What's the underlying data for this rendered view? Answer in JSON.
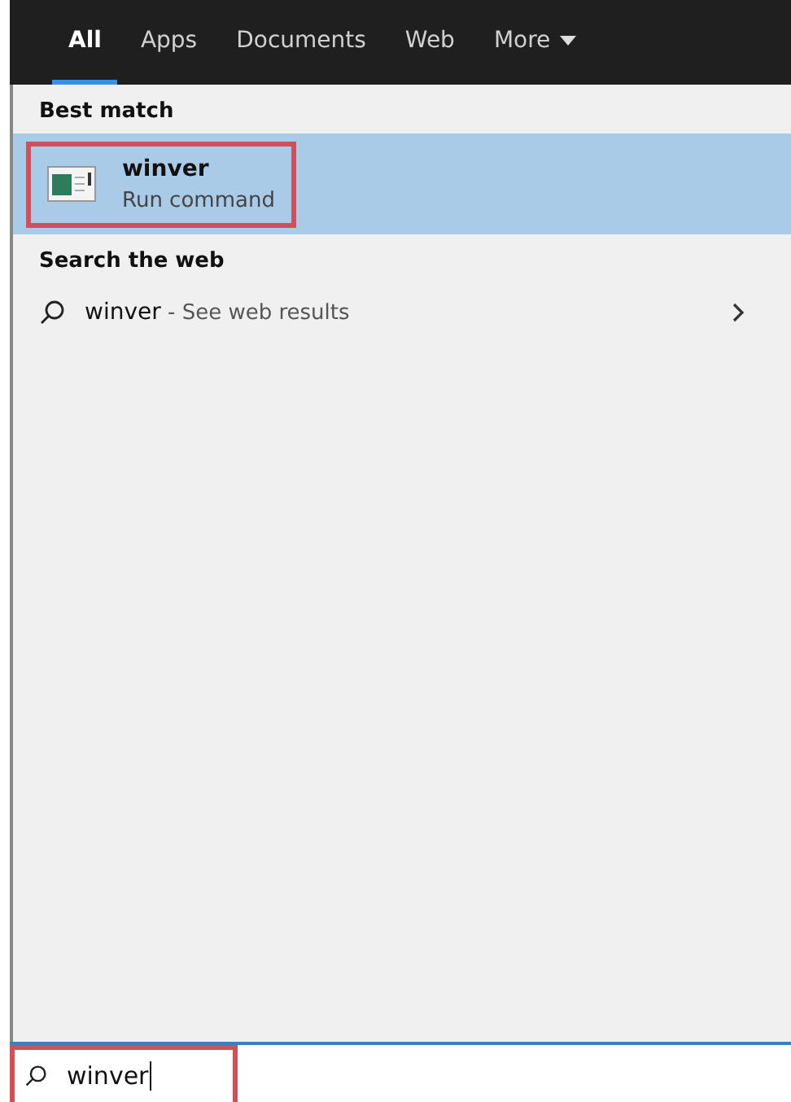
{
  "tabs": [
    {
      "label": "All",
      "selected": true
    },
    {
      "label": "Apps",
      "selected": false
    },
    {
      "label": "Documents",
      "selected": false
    },
    {
      "label": "Web",
      "selected": false
    },
    {
      "label": "More",
      "selected": false,
      "kind": "dropdown"
    }
  ],
  "best_match": {
    "heading": "Best match",
    "title": "winver",
    "subtitle": "Run command",
    "selected": true,
    "highlighted": true
  },
  "web": {
    "heading": "Search the web",
    "query": "winver",
    "hint": " - See web results"
  },
  "search": {
    "value": "winver",
    "highlighted": true
  }
}
